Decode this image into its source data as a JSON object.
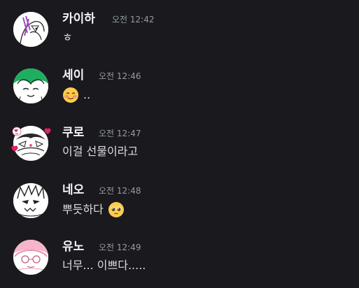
{
  "messages": [
    {
      "author": "카이하",
      "timestamp": "오전 12:42",
      "text": "ㅎ",
      "emoji_after": null,
      "avatar": {
        "icon": "kaiha-avatar",
        "bg": "#ffffff",
        "accent": "#9b4fb8"
      }
    },
    {
      "author": "세이",
      "timestamp": "오전 12:46",
      "emoji_before": "smiling-face-with-blush-emoji",
      "text": "..",
      "avatar": {
        "icon": "sei-avatar",
        "bg": "#ffffff",
        "accent": "#1fae5f"
      }
    },
    {
      "author": "쿠로",
      "timestamp": "오전 12:47",
      "text": "이걸 선물이라고",
      "avatar": {
        "icon": "kuro-avatar",
        "bg": "#ffffff",
        "accent": "#e05a8a"
      }
    },
    {
      "author": "네오",
      "timestamp": "오전 12:48",
      "text": "뿌듯하다",
      "emoji_after": "pleading-face-emoji",
      "avatar": {
        "icon": "neo-avatar",
        "bg": "#ffffff",
        "accent": "#222222"
      }
    },
    {
      "author": "유노",
      "timestamp": "오전 12:49",
      "text": "너무... 이쁘다.....",
      "avatar": {
        "icon": "yuno-avatar",
        "bg": "#ffffff",
        "accent": "#f08fb0"
      }
    }
  ],
  "colors": {
    "background": "#1a1a1e",
    "author_name": "#f2f3f5",
    "timestamp": "#949ba4",
    "message_text": "#dbdee1"
  }
}
